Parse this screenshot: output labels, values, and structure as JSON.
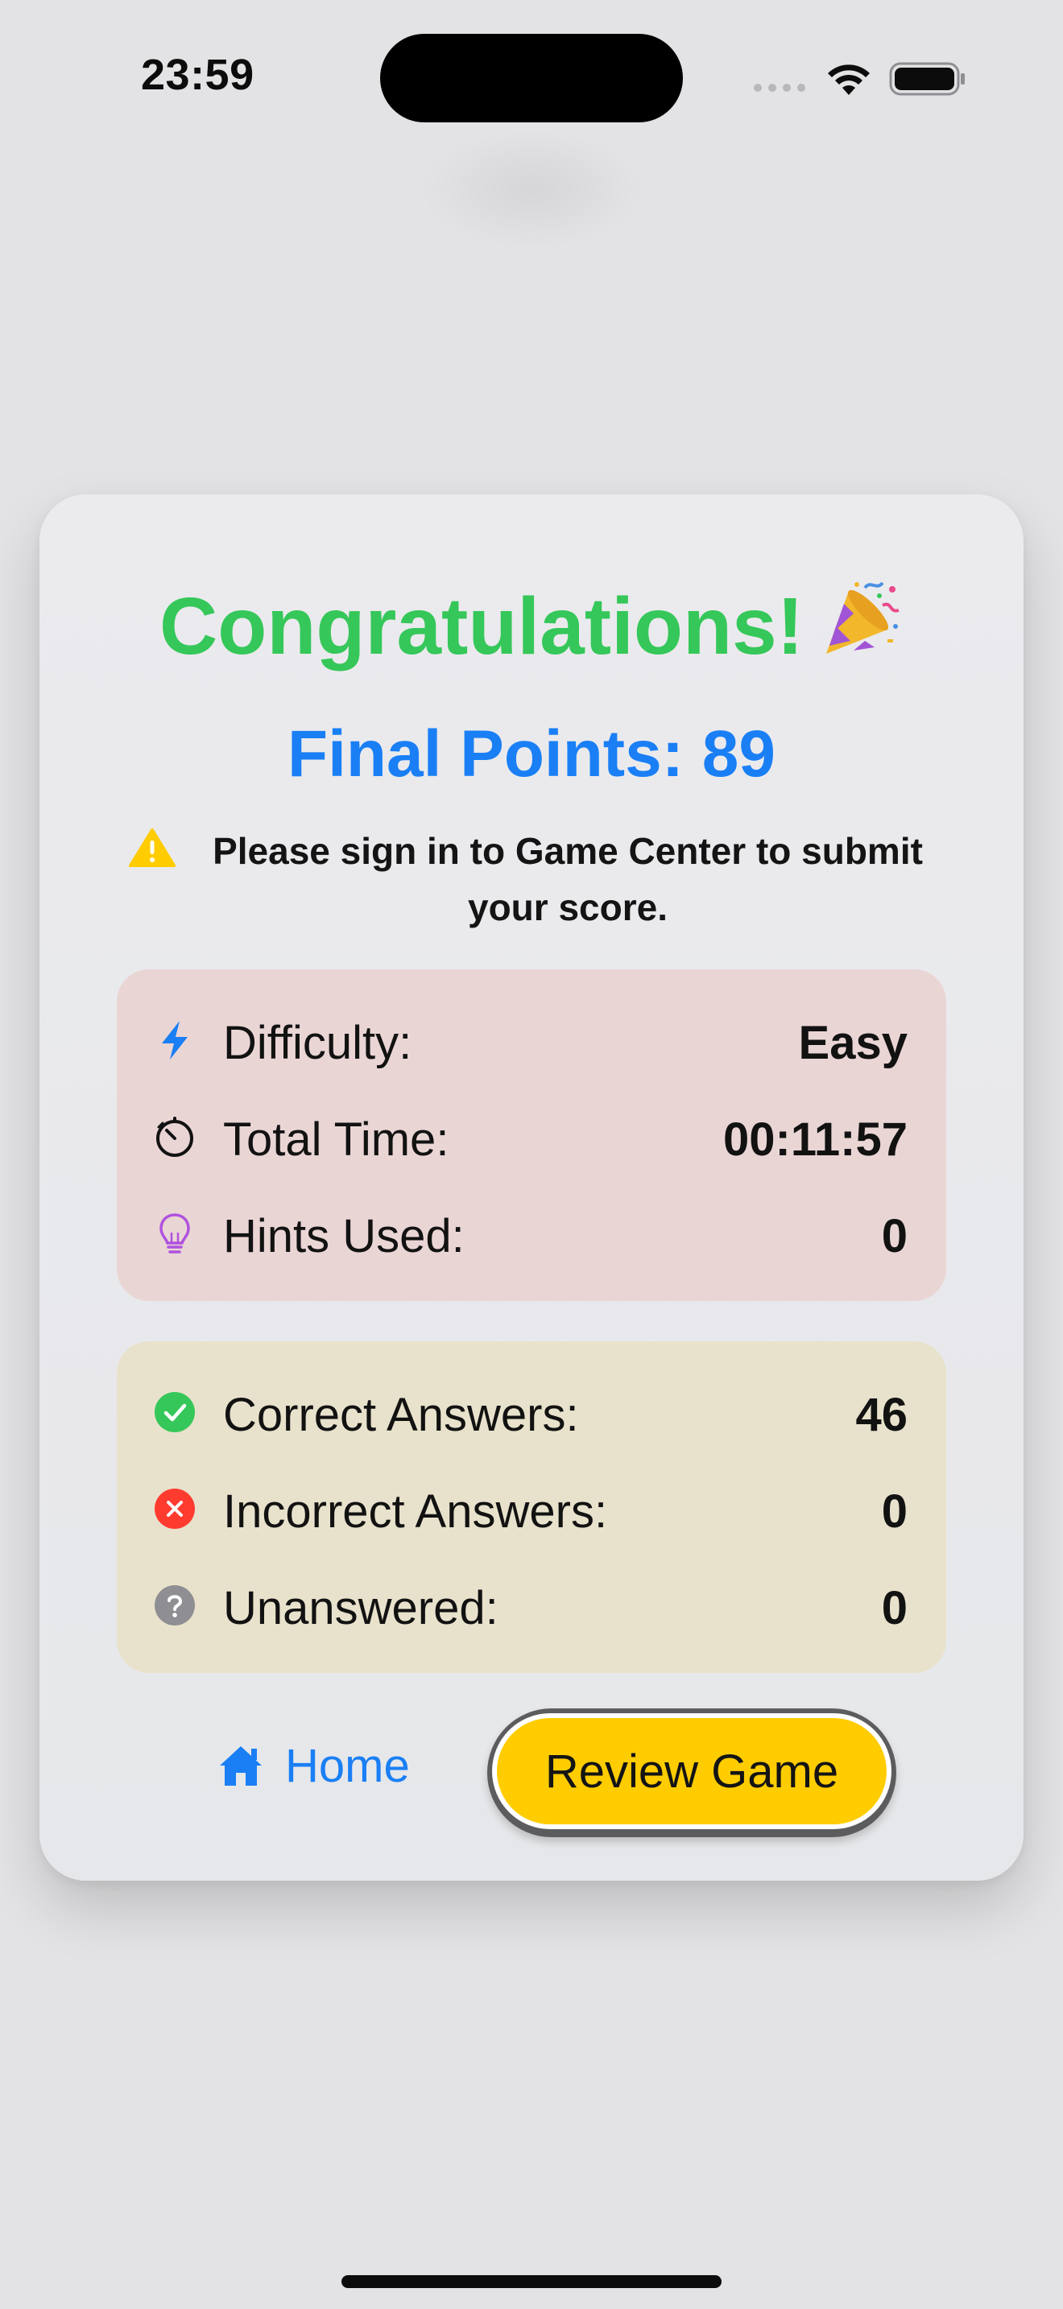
{
  "status_bar": {
    "time": "23:59"
  },
  "card": {
    "title": "Congratulations!",
    "title_emoji_icon": "party-popper-icon",
    "final_points_label": "Final Points: 89",
    "warning_icon": "warning-triangle-icon",
    "warning_text": "Please sign in to Game Center to submit your score."
  },
  "game_stats": [
    {
      "icon": "bolt-icon",
      "label": "Difficulty:",
      "value": "Easy"
    },
    {
      "icon": "timer-icon",
      "label": "Total Time:",
      "value": "00:11:57"
    },
    {
      "icon": "lightbulb-icon",
      "label": "Hints Used:",
      "value": "0"
    }
  ],
  "answer_stats": [
    {
      "icon": "check-circle-icon",
      "label": "Correct Answers:",
      "value": "46"
    },
    {
      "icon": "x-circle-icon",
      "label": "Incorrect Answers:",
      "value": "0"
    },
    {
      "icon": "question-circle-icon",
      "label": "Unanswered:",
      "value": "0"
    }
  ],
  "buttons": {
    "home_label": "Home",
    "review_label": "Review Game"
  },
  "colors": {
    "title_green": "#35c759",
    "accent_blue": "#1a7ff5",
    "review_yellow": "#ffcc00",
    "panel_game_bg": "#ead5d5",
    "panel_answers_bg": "#e8e2cc",
    "hint_purple": "#af52de",
    "incorrect_red": "#ff3b30",
    "unanswered_gray": "#8e8e93"
  }
}
